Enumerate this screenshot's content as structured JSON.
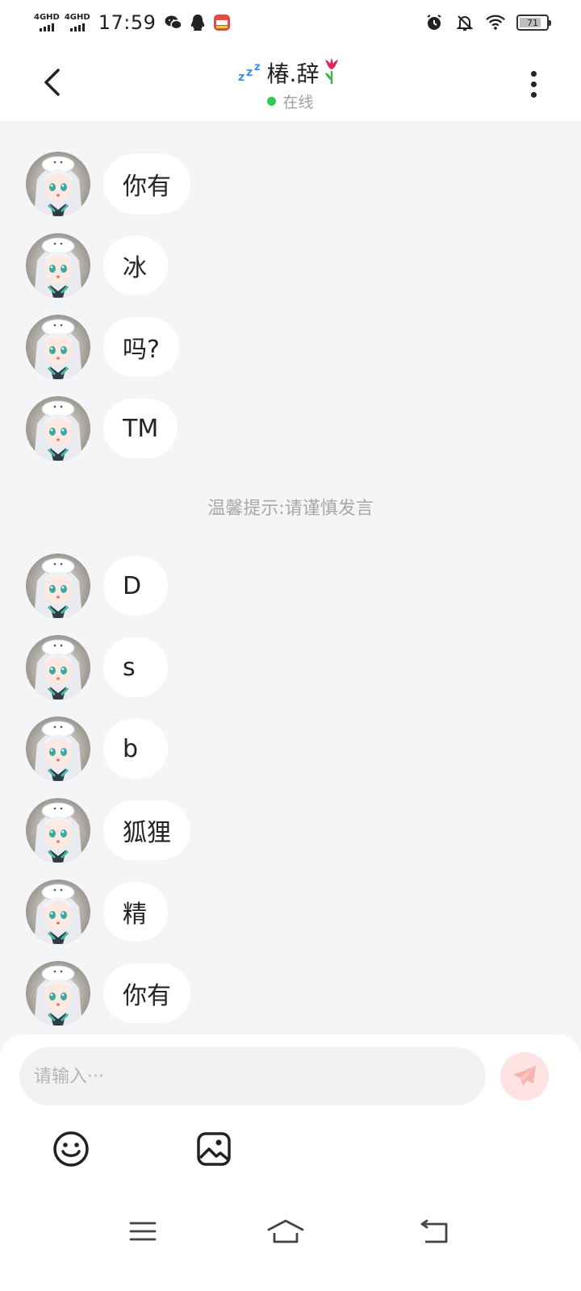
{
  "status_bar": {
    "network_1": "4GHD",
    "network_2": "4GHD",
    "time": "17:59",
    "battery_level": "71",
    "icons": [
      "wechat-icon",
      "qq-icon",
      "app-icon",
      "alarm-icon",
      "bell-off-icon",
      "wifi-icon",
      "battery-icon"
    ]
  },
  "header": {
    "title": "椿.辞",
    "title_prefix_icon": "sleep-zzz-icon",
    "title_suffix_icon": "tulip-icon",
    "status": "在线",
    "status_color": "#2fc850"
  },
  "messages": [
    {
      "text": "你有"
    },
    {
      "text": "冰"
    },
    {
      "text": "吗?"
    },
    {
      "text": "TM"
    },
    {
      "text": "D"
    },
    {
      "text": "s"
    },
    {
      "text": "b"
    },
    {
      "text": "狐狸"
    },
    {
      "text": "精"
    },
    {
      "text": "你有"
    }
  ],
  "tip": "温馨提示:请谨慎发言",
  "composer": {
    "placeholder": "请输入···",
    "send_color": "#f36a5f",
    "tools": [
      "emoji-icon",
      "image-icon"
    ]
  },
  "nav": [
    "menu-icon",
    "home-icon",
    "back-nav-icon"
  ]
}
